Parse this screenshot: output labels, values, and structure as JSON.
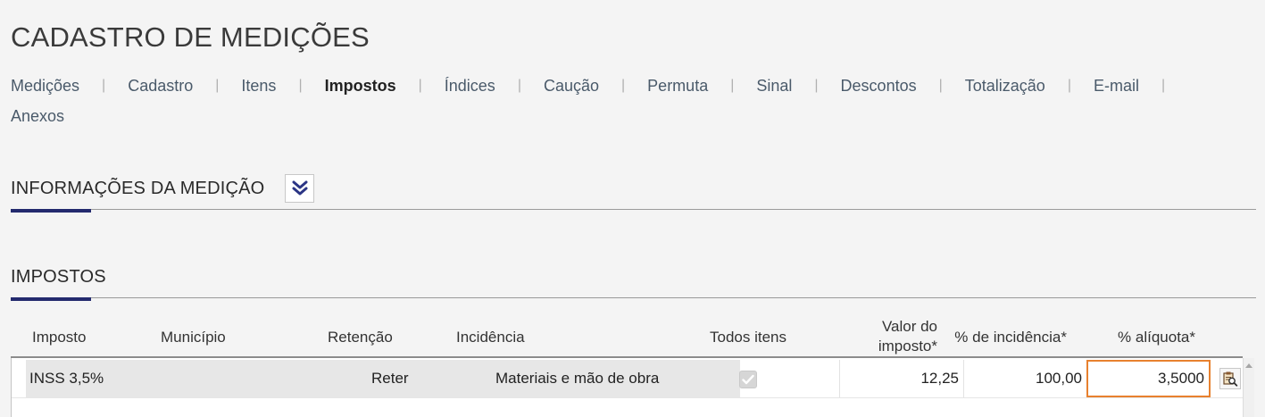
{
  "page": {
    "title": "CADASTRO DE MEDIÇÕES"
  },
  "tabs": {
    "row1": [
      {
        "label": "Medições",
        "active": false
      },
      {
        "label": "Cadastro",
        "active": false
      },
      {
        "label": "Itens",
        "active": false
      },
      {
        "label": "Impostos",
        "active": true
      },
      {
        "label": "Índices",
        "active": false
      },
      {
        "label": "Caução",
        "active": false
      },
      {
        "label": "Permuta",
        "active": false
      },
      {
        "label": "Sinal",
        "active": false
      },
      {
        "label": "Descontos",
        "active": false
      },
      {
        "label": "Totalização",
        "active": false
      },
      {
        "label": "E-mail",
        "active": false
      }
    ],
    "row2": [
      {
        "label": "Anexos",
        "active": false
      }
    ],
    "separator": "|"
  },
  "sections": {
    "info": {
      "title": "INFORMAÇÕES DA MEDIÇÃO",
      "toggle_icon": "double-chevron-down-icon"
    },
    "impostos": {
      "title": "IMPOSTOS"
    }
  },
  "grid": {
    "columns": {
      "imposto": "Imposto",
      "municipio": "Município",
      "retencao": "Retenção",
      "incidencia": "Incidência",
      "todos_itens": "Todos itens",
      "valor_line1": "Valor do",
      "valor_line2": "imposto*",
      "pct_incidencia": "% de incidência*",
      "pct_aliquota": "% alíquota*"
    },
    "rows": [
      {
        "imposto": "INSS 3,5%",
        "municipio": "",
        "retencao": "Reter",
        "incidencia": "Materiais e mão de obra",
        "todos_itens": true,
        "valor_imposto": "12,25",
        "pct_incidencia": "100,00",
        "pct_aliquota": "3,5000"
      }
    ]
  },
  "colors": {
    "accent": "#232a6e",
    "focus": "#e8812f",
    "toggle_icon": "#2b3585"
  }
}
